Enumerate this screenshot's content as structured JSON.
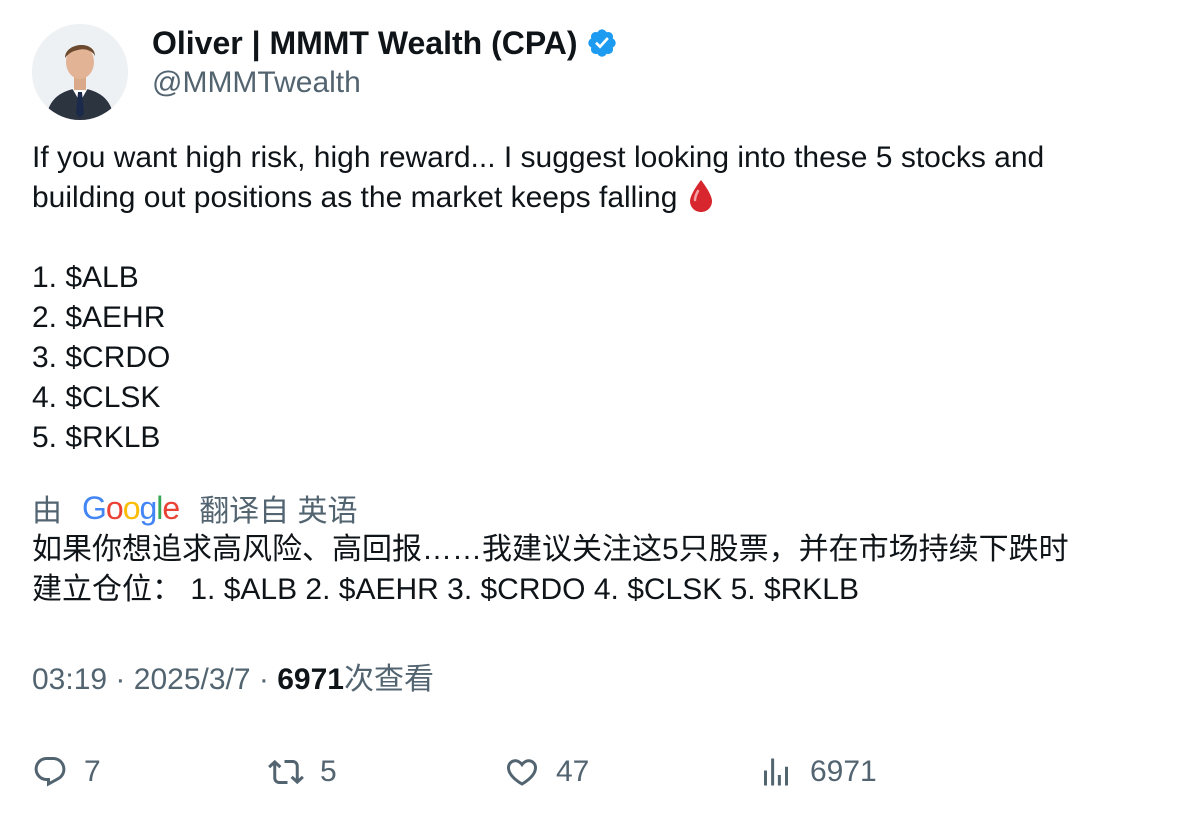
{
  "author": {
    "display_name": "Oliver | MMMT Wealth (CPA)",
    "handle": "@MMMTwealth",
    "verified_color": "#1d9bf0"
  },
  "tweet": {
    "intro_line1": "If you want high risk, high reward... I suggest looking into these 5 stocks and",
    "intro_line2": "building out positions as the market keeps falling",
    "stocks": [
      "1. $ALB",
      "2. $AEHR",
      "3. $CRDO",
      "4. $CLSK",
      "5. $RKLB"
    ]
  },
  "translation": {
    "prefix": "由",
    "logo_letters": [
      "G",
      "o",
      "o",
      "g",
      "l",
      "e"
    ],
    "suffix": "翻译自 英语",
    "line1": "如果你想追求高风险、高回报……我建议关注这5只股票，并在市场持续下跌时",
    "line2": "建立仓位： 1. $ALB 2. $AEHR 3. $CRDO 4. $CLSK 5. $RKLB"
  },
  "meta": {
    "time": "03:19",
    "separator": "·",
    "date": "2025/3/7",
    "views_count": "6971",
    "views_label": "次查看"
  },
  "actions": {
    "replies": "7",
    "retweets": "5",
    "likes": "47",
    "views": "6971"
  }
}
